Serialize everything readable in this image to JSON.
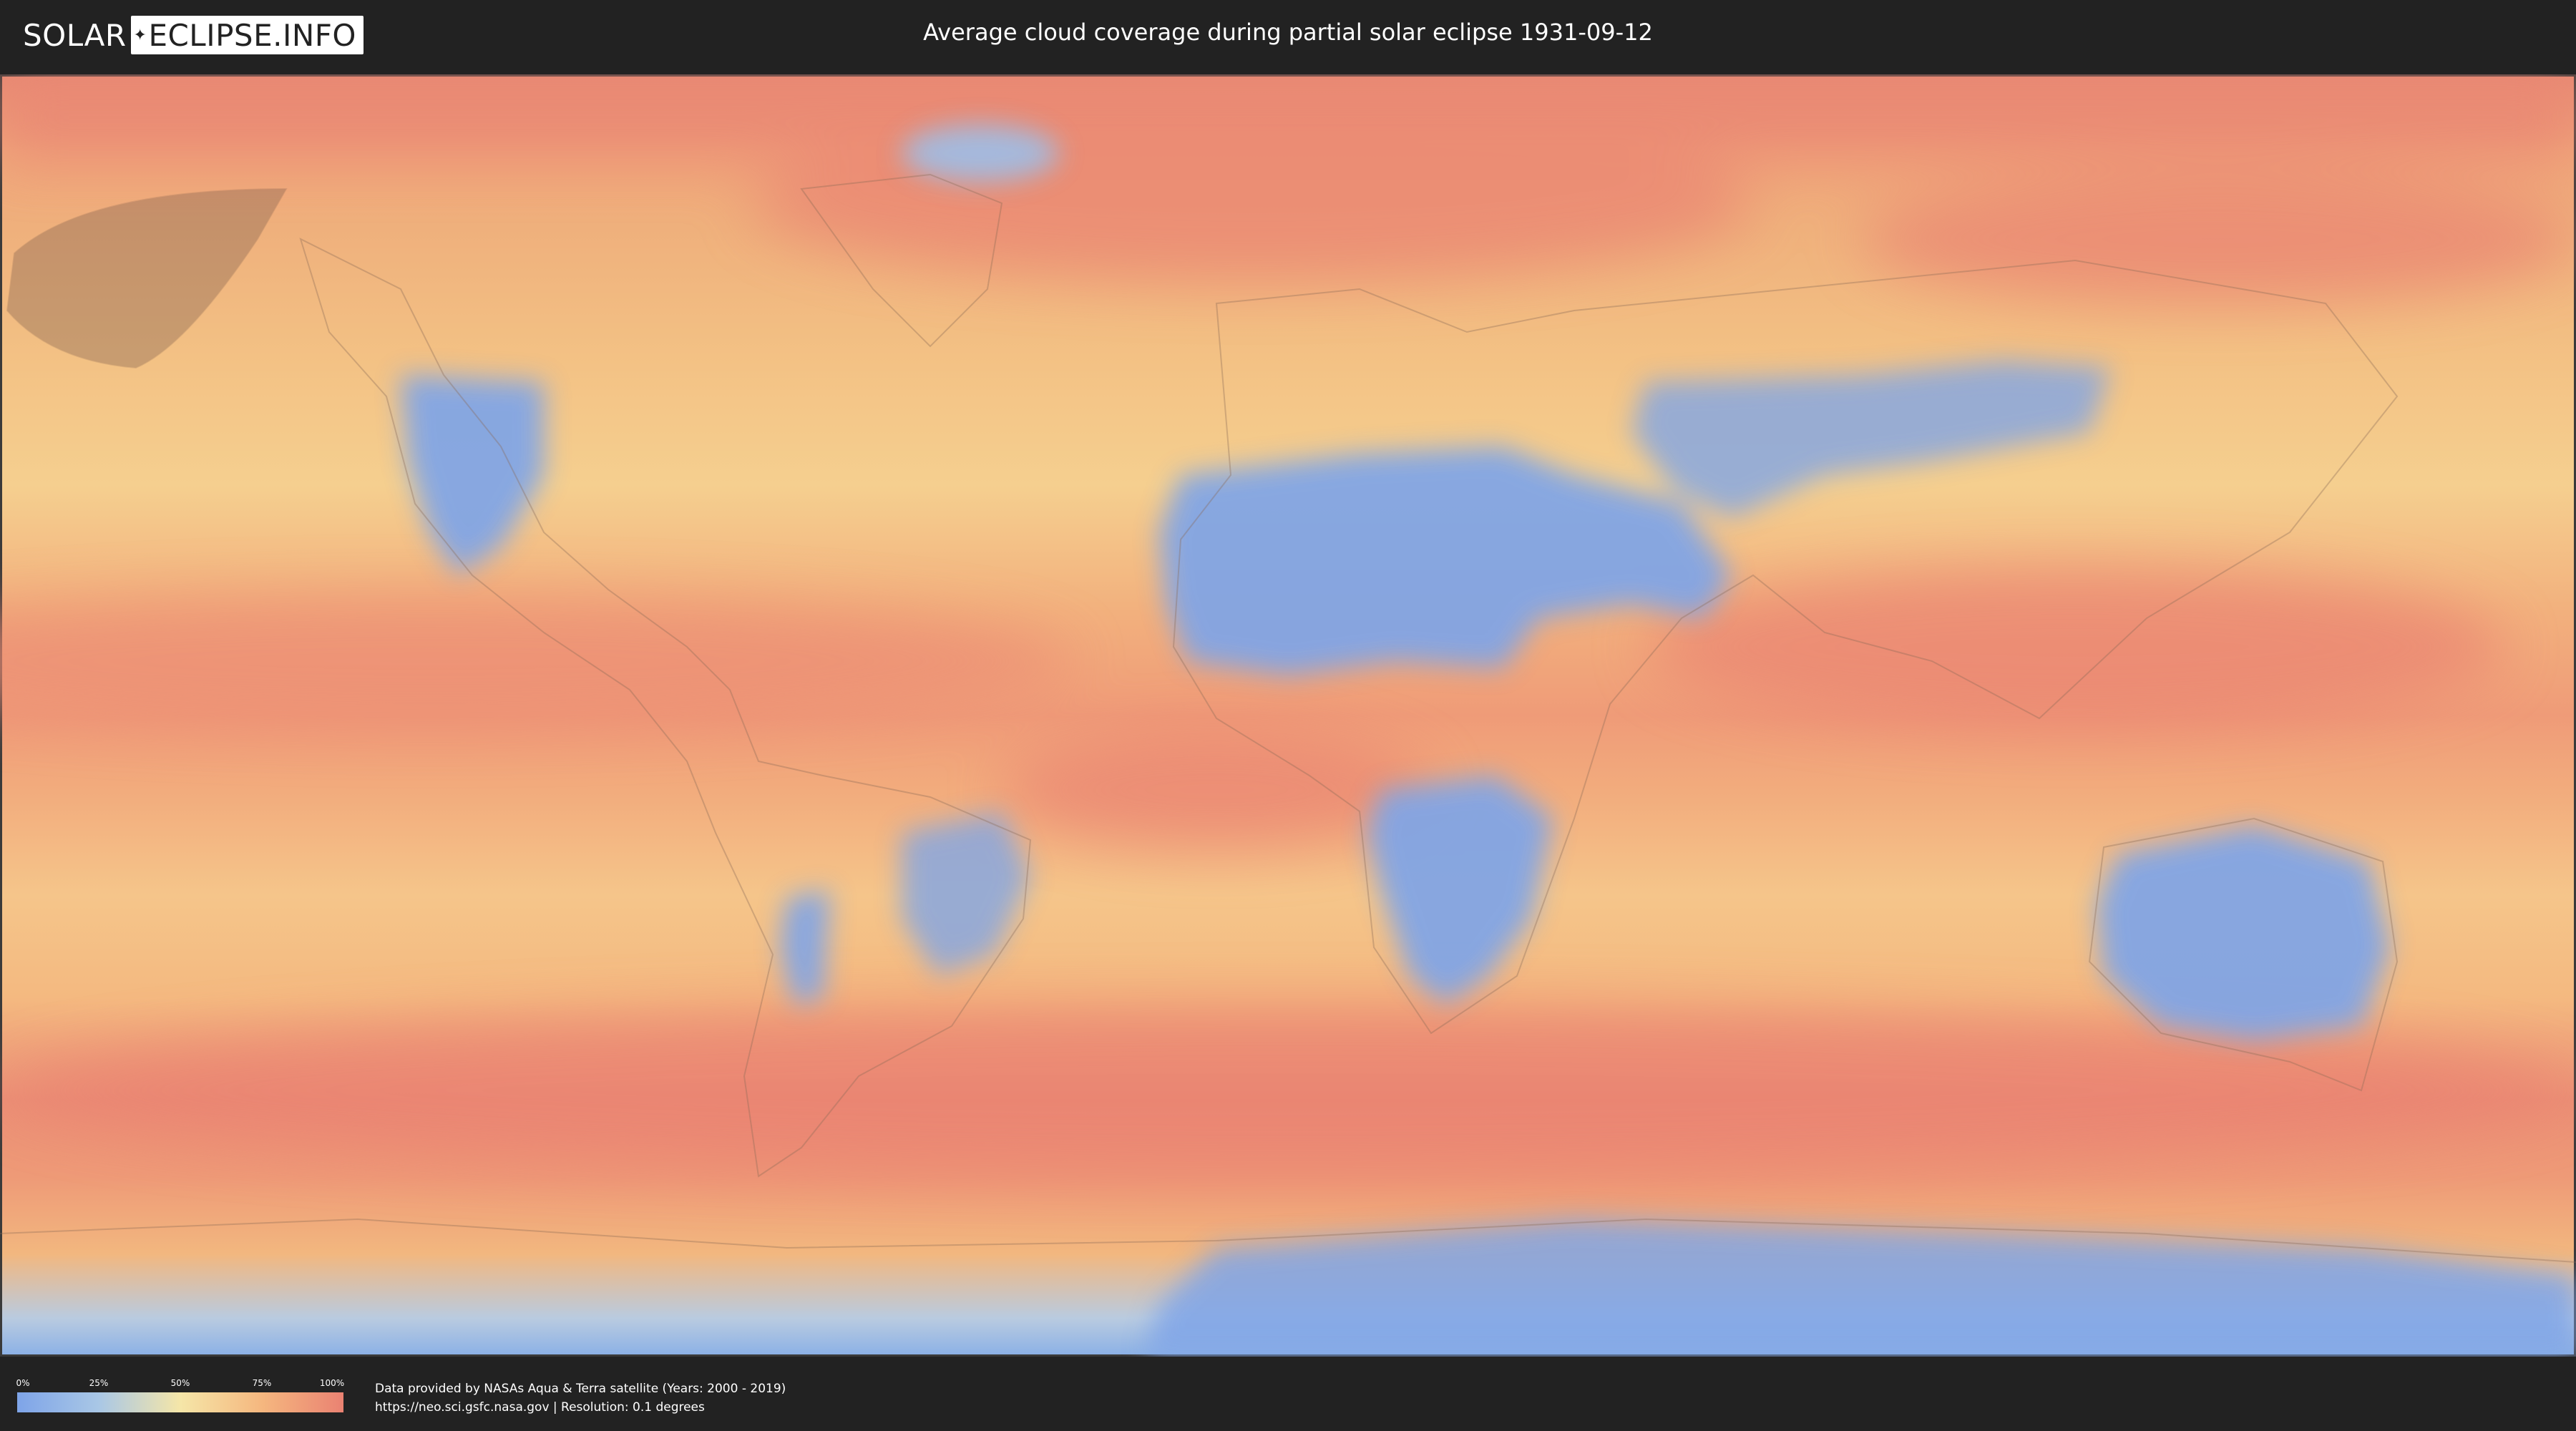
{
  "header": {
    "logo_left": "SOLAR",
    "logo_right": "ECLIPSE.INFO",
    "title": "Average cloud coverage during partial solar eclipse 1931-09-12"
  },
  "legend": {
    "ticks": [
      "0%",
      "25%",
      "50%",
      "75%",
      "100%"
    ],
    "colors": [
      "#7ea4e8",
      "#a9c7e6",
      "#f5e6a8",
      "#f5b77f",
      "#ea8272"
    ]
  },
  "credits": {
    "line1": "Data provided by NASAs Aqua & Terra satellite (Years: 2000 - 2019)",
    "line2": "https://neo.sci.gsfc.nasa.gov | Resolution: 0.1 degrees"
  },
  "map": {
    "clear_color": "#7ea4e8",
    "cloudy_color": "#ea8272",
    "eclipse_shadow_color": "#7a5a4a"
  }
}
